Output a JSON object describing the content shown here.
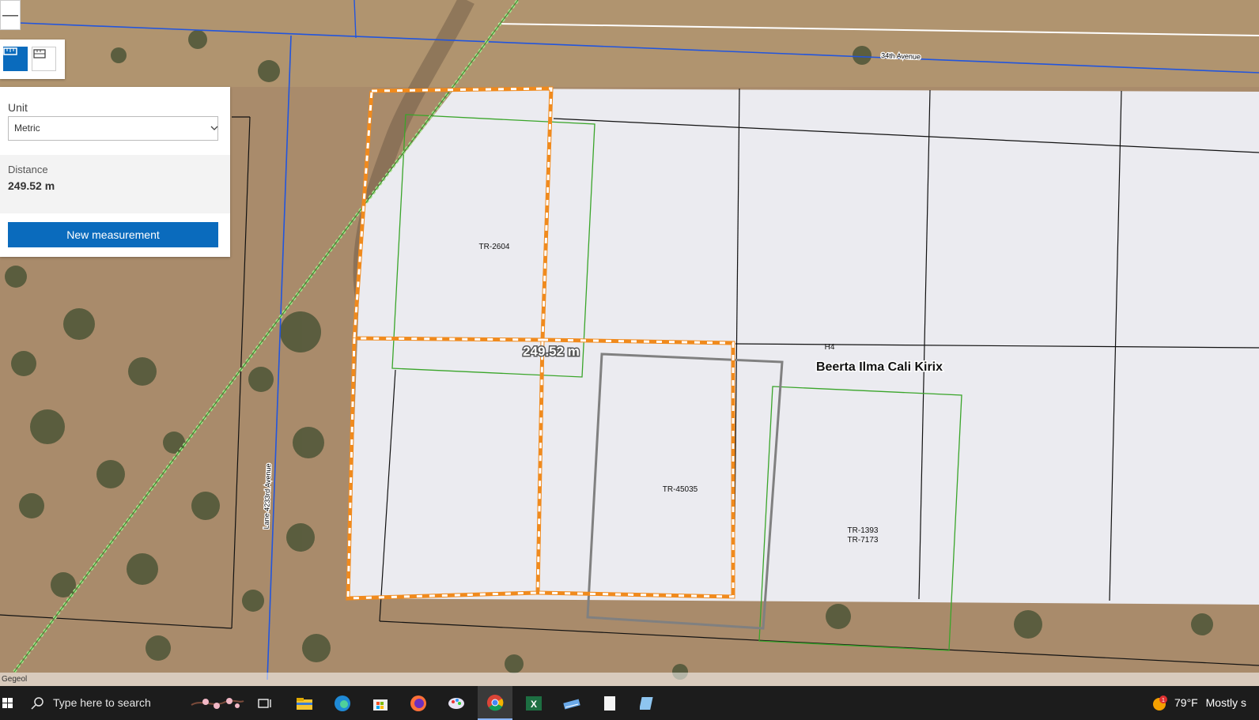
{
  "map": {
    "road_label_top": "34th Avenue",
    "road_label_side": "Lane 4233rd Avenue",
    "parcel_labels": [
      "TR-2604",
      "TR-45035",
      "TR-1393",
      "TR-7173",
      "H4"
    ],
    "area_label": "Beerta Ilma Cali Kirix",
    "measurement_label": "249.52 m",
    "attribution": "Gegeol"
  },
  "zoom": {
    "zoom_out_label": "—"
  },
  "tools": [
    {
      "icon": "distance-measure-icon",
      "active": true
    },
    {
      "icon": "area-measure-icon",
      "active": false
    }
  ],
  "measure_panel": {
    "unit_label": "Unit",
    "unit_value": "Metric",
    "distance_label": "Distance",
    "distance_value": "249.52 m",
    "new_button": "New measurement"
  },
  "taskbar": {
    "search_placeholder": "Type here to search",
    "weather_badge": "1",
    "temperature": "79°F",
    "weather_text": "Mostly s",
    "apps": [
      "file-explorer-icon",
      "edge-icon",
      "store-icon",
      "firefox-icon",
      "paint-icon",
      "chrome-icon",
      "excel-icon",
      "snip-icon",
      "notepad-icon",
      "app-icon"
    ]
  },
  "colors": {
    "accent": "#0a6bbd",
    "measure_line": "#f08a1d",
    "parcel_fill": "#ebebf0",
    "road_line": "#2255dd",
    "taskbar": "#1c1c1c"
  }
}
